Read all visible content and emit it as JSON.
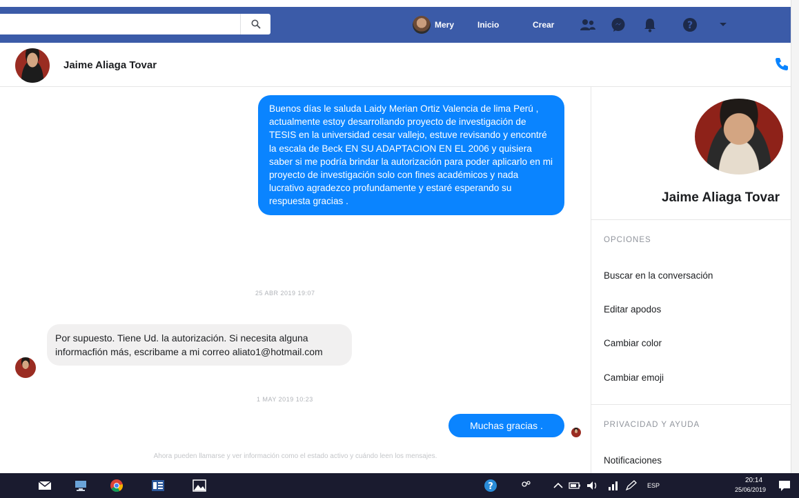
{
  "topbar": {
    "user_name": "Mery",
    "home_label": "Inicio",
    "create_label": "Crear"
  },
  "conversation": {
    "contact_name": "Jaime Aliaga Tovar",
    "messages": [
      {
        "direction": "out",
        "text": "Buenos días le saluda Laidy Merian Ortiz Valencia de lima Perú , actualmente estoy desarrollando proyecto de investigación de TESIS   en la universidad cesar vallejo,  estuve revisando y encontré la  escala  de Beck EN SU ADAPTACION EN EL 2006  y quisiera saber si me podría brindar la autorización para poder aplicarlo  en mi proyecto de investigación solo con fines académicos y nada lucrativo agradezco profundamente y estaré esperando su respuesta gracias ."
      },
      {
        "type": "timestamp",
        "text": "25 ABR 2019 19:07"
      },
      {
        "direction": "in",
        "text": "Por supuesto. Tiene Ud. la autorización. Si necesita alguna informacfión más, escribame a mi correo  aliato1@hotmail.com"
      },
      {
        "type": "timestamp",
        "text": "1 MAY 2019 10:23"
      },
      {
        "direction": "out",
        "text": "Muchas gracias ."
      }
    ],
    "notice": "Ahora pueden llamarse y ver información como el estado activo y cuándo leen los mensajes."
  },
  "panel": {
    "name": "Jaime Aliaga Tovar",
    "options_title": "OPCIONES",
    "options": [
      "Buscar en la conversación",
      "Editar apodos",
      "Cambiar color",
      "Cambiar emoji"
    ],
    "privacy_title": "PRIVACIDAD Y AYUDA",
    "privacy_items": [
      "Notificaciones"
    ]
  },
  "taskbar": {
    "language": "ESP",
    "time": "20:14",
    "date": "25/06/2019"
  },
  "colors": {
    "topbar": "#3b5ba8",
    "bubble_out": "#0a84ff",
    "bubble_in": "#f1f0f0",
    "taskbar": "#1a1b2f"
  }
}
